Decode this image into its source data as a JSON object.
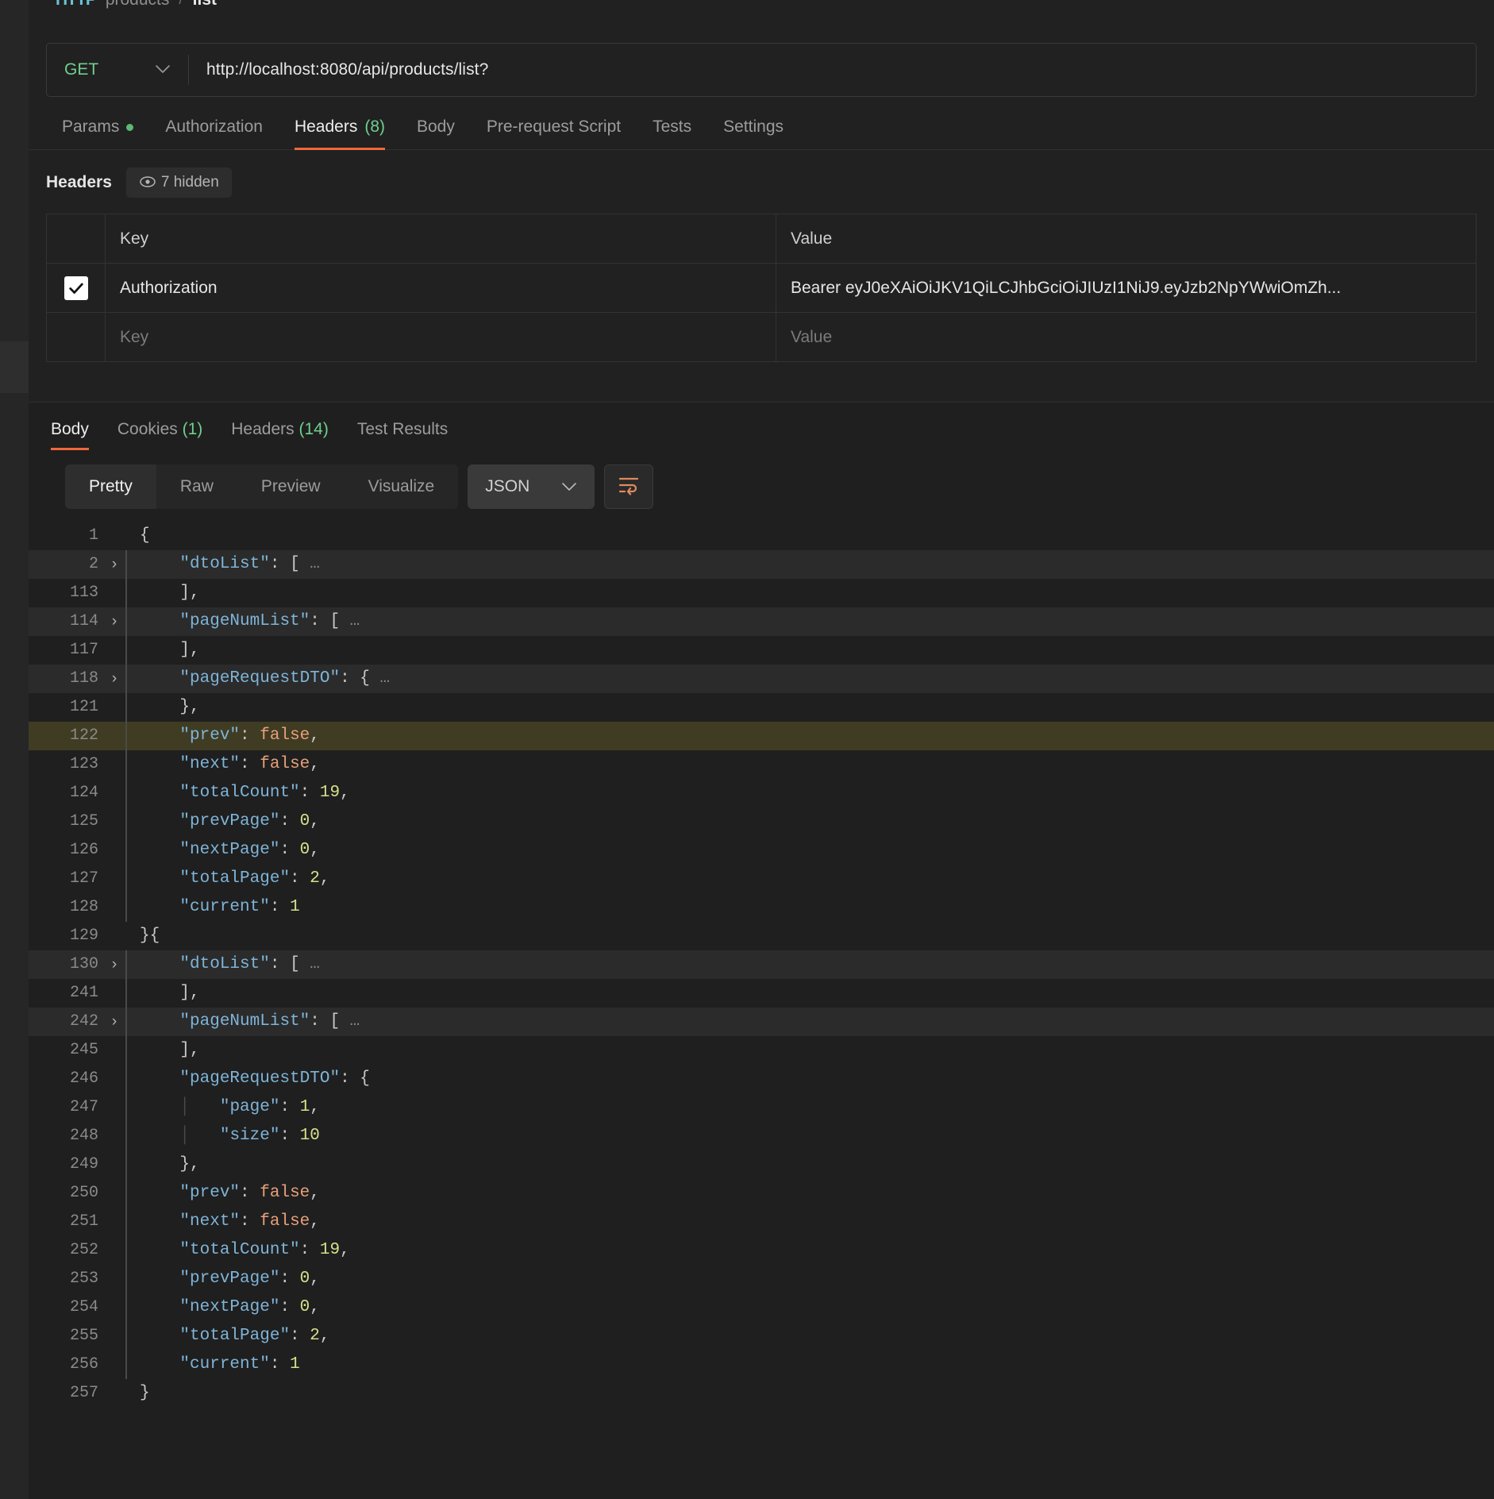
{
  "breadcrumb": {
    "icon": "http-icon",
    "segments": [
      "products"
    ],
    "separator": "/",
    "current": "list"
  },
  "request": {
    "method": "GET",
    "method_caret": "chevron-down-icon",
    "url": "http://localhost:8080/api/products/list?",
    "tabs": [
      {
        "label": "Params",
        "badge_dot": true,
        "active": false
      },
      {
        "label": "Authorization",
        "active": false
      },
      {
        "label": "Headers",
        "count": "(8)",
        "active": true
      },
      {
        "label": "Body",
        "active": false
      },
      {
        "label": "Pre-request Script",
        "active": false
      },
      {
        "label": "Tests",
        "active": false
      },
      {
        "label": "Settings",
        "active": false
      }
    ]
  },
  "headers_section": {
    "title": "Headers",
    "hidden_pill": "7 hidden",
    "columns": {
      "key": "Key",
      "value": "Value"
    },
    "rows": [
      {
        "checked": true,
        "key": "Authorization",
        "value": "Bearer eyJ0eXAiOiJKV1QiLCJhbGciOiJIUzI1NiJ9.eyJzb2NpYWwiOmZh..."
      }
    ],
    "placeholder_row": {
      "key": "Key",
      "value": "Value"
    }
  },
  "response": {
    "tabs": [
      {
        "label": "Body",
        "active": true
      },
      {
        "label": "Cookies",
        "count": "(1)",
        "active": false
      },
      {
        "label": "Headers",
        "count": "(14)",
        "active": false
      },
      {
        "label": "Test Results",
        "active": false
      }
    ],
    "format_buttons": [
      {
        "label": "Pretty",
        "active": true
      },
      {
        "label": "Raw",
        "active": false
      },
      {
        "label": "Preview",
        "active": false
      },
      {
        "label": "Visualize",
        "active": false
      }
    ],
    "language_select": {
      "value": "JSON",
      "caret": "chevron-down-icon"
    },
    "wrap_button": "word-wrap-icon"
  },
  "colors": {
    "accent": "#f0673a",
    "green": "#6fcf8e",
    "key": "#7fb4d8",
    "bool": "#e8a07a",
    "number": "#d7e08a",
    "highlight_row": "#3f3c23"
  },
  "code_lines": [
    {
      "n": "1",
      "arrow": false,
      "bar": false,
      "hl": "none",
      "tokens": [
        {
          "t": "brk",
          "v": "{"
        }
      ]
    },
    {
      "n": "2",
      "arrow": true,
      "bar": true,
      "hl": "grey",
      "tokens": [
        {
          "t": "sp",
          "v": "    "
        },
        {
          "t": "k",
          "v": "\"dtoList\""
        },
        {
          "t": "p",
          "v": ": "
        },
        {
          "t": "brk",
          "v": "["
        },
        {
          "t": "ell",
          "v": " …"
        }
      ]
    },
    {
      "n": "113",
      "arrow": false,
      "bar": true,
      "hl": "none",
      "tokens": [
        {
          "t": "sp",
          "v": "    "
        },
        {
          "t": "brk",
          "v": "],"
        }
      ]
    },
    {
      "n": "114",
      "arrow": true,
      "bar": true,
      "hl": "grey",
      "tokens": [
        {
          "t": "sp",
          "v": "    "
        },
        {
          "t": "k",
          "v": "\"pageNumList\""
        },
        {
          "t": "p",
          "v": ": "
        },
        {
          "t": "brk",
          "v": "["
        },
        {
          "t": "ell",
          "v": " …"
        }
      ]
    },
    {
      "n": "117",
      "arrow": false,
      "bar": true,
      "hl": "none",
      "tokens": [
        {
          "t": "sp",
          "v": "    "
        },
        {
          "t": "brk",
          "v": "],"
        }
      ]
    },
    {
      "n": "118",
      "arrow": true,
      "bar": true,
      "hl": "grey",
      "tokens": [
        {
          "t": "sp",
          "v": "    "
        },
        {
          "t": "k",
          "v": "\"pageRequestDTO\""
        },
        {
          "t": "p",
          "v": ": "
        },
        {
          "t": "brk",
          "v": "{"
        },
        {
          "t": "ell",
          "v": " …"
        }
      ]
    },
    {
      "n": "121",
      "arrow": false,
      "bar": true,
      "hl": "none",
      "tokens": [
        {
          "t": "sp",
          "v": "    "
        },
        {
          "t": "brk",
          "v": "},"
        }
      ]
    },
    {
      "n": "122",
      "arrow": false,
      "bar": true,
      "hl": "olive",
      "tokens": [
        {
          "t": "sp",
          "v": "    "
        },
        {
          "t": "k",
          "v": "\"prev\""
        },
        {
          "t": "p",
          "v": ": "
        },
        {
          "t": "bool",
          "v": "false"
        },
        {
          "t": "p",
          "v": ","
        }
      ]
    },
    {
      "n": "123",
      "arrow": false,
      "bar": true,
      "hl": "none",
      "tokens": [
        {
          "t": "sp",
          "v": "    "
        },
        {
          "t": "k",
          "v": "\"next\""
        },
        {
          "t": "p",
          "v": ": "
        },
        {
          "t": "bool",
          "v": "false"
        },
        {
          "t": "p",
          "v": ","
        }
      ]
    },
    {
      "n": "124",
      "arrow": false,
      "bar": true,
      "hl": "none",
      "tokens": [
        {
          "t": "sp",
          "v": "    "
        },
        {
          "t": "k",
          "v": "\"totalCount\""
        },
        {
          "t": "p",
          "v": ": "
        },
        {
          "t": "num",
          "v": "19"
        },
        {
          "t": "p",
          "v": ","
        }
      ]
    },
    {
      "n": "125",
      "arrow": false,
      "bar": true,
      "hl": "none",
      "tokens": [
        {
          "t": "sp",
          "v": "    "
        },
        {
          "t": "k",
          "v": "\"prevPage\""
        },
        {
          "t": "p",
          "v": ": "
        },
        {
          "t": "num",
          "v": "0"
        },
        {
          "t": "p",
          "v": ","
        }
      ]
    },
    {
      "n": "126",
      "arrow": false,
      "bar": true,
      "hl": "none",
      "tokens": [
        {
          "t": "sp",
          "v": "    "
        },
        {
          "t": "k",
          "v": "\"nextPage\""
        },
        {
          "t": "p",
          "v": ": "
        },
        {
          "t": "num",
          "v": "0"
        },
        {
          "t": "p",
          "v": ","
        }
      ]
    },
    {
      "n": "127",
      "arrow": false,
      "bar": true,
      "hl": "none",
      "tokens": [
        {
          "t": "sp",
          "v": "    "
        },
        {
          "t": "k",
          "v": "\"totalPage\""
        },
        {
          "t": "p",
          "v": ": "
        },
        {
          "t": "num",
          "v": "2"
        },
        {
          "t": "p",
          "v": ","
        }
      ]
    },
    {
      "n": "128",
      "arrow": false,
      "bar": true,
      "hl": "none",
      "tokens": [
        {
          "t": "sp",
          "v": "    "
        },
        {
          "t": "k",
          "v": "\"current\""
        },
        {
          "t": "p",
          "v": ": "
        },
        {
          "t": "num",
          "v": "1"
        }
      ]
    },
    {
      "n": "129",
      "arrow": false,
      "bar": false,
      "hl": "none",
      "tokens": [
        {
          "t": "brk",
          "v": "}{"
        }
      ]
    },
    {
      "n": "130",
      "arrow": true,
      "bar": true,
      "hl": "grey",
      "tokens": [
        {
          "t": "sp",
          "v": "    "
        },
        {
          "t": "k",
          "v": "\"dtoList\""
        },
        {
          "t": "p",
          "v": ": "
        },
        {
          "t": "brk",
          "v": "["
        },
        {
          "t": "ell",
          "v": " …"
        }
      ]
    },
    {
      "n": "241",
      "arrow": false,
      "bar": true,
      "hl": "none",
      "tokens": [
        {
          "t": "sp",
          "v": "    "
        },
        {
          "t": "brk",
          "v": "],"
        }
      ]
    },
    {
      "n": "242",
      "arrow": true,
      "bar": true,
      "hl": "grey",
      "tokens": [
        {
          "t": "sp",
          "v": "    "
        },
        {
          "t": "k",
          "v": "\"pageNumList\""
        },
        {
          "t": "p",
          "v": ": "
        },
        {
          "t": "brk",
          "v": "["
        },
        {
          "t": "ell",
          "v": " …"
        }
      ]
    },
    {
      "n": "245",
      "arrow": false,
      "bar": true,
      "hl": "none",
      "tokens": [
        {
          "t": "sp",
          "v": "    "
        },
        {
          "t": "brk",
          "v": "],"
        }
      ]
    },
    {
      "n": "246",
      "arrow": false,
      "bar": true,
      "hl": "none",
      "tokens": [
        {
          "t": "sp",
          "v": "    "
        },
        {
          "t": "k",
          "v": "\"pageRequestDTO\""
        },
        {
          "t": "p",
          "v": ": "
        },
        {
          "t": "brk",
          "v": "{"
        }
      ]
    },
    {
      "n": "247",
      "arrow": false,
      "bar": true,
      "hl": "none",
      "tokens": [
        {
          "t": "sp",
          "v": "    "
        },
        {
          "t": "innerbar",
          "v": "│"
        },
        {
          "t": "sp",
          "v": "   "
        },
        {
          "t": "k",
          "v": "\"page\""
        },
        {
          "t": "p",
          "v": ": "
        },
        {
          "t": "num",
          "v": "1"
        },
        {
          "t": "p",
          "v": ","
        }
      ]
    },
    {
      "n": "248",
      "arrow": false,
      "bar": true,
      "hl": "none",
      "tokens": [
        {
          "t": "sp",
          "v": "    "
        },
        {
          "t": "innerbar",
          "v": "│"
        },
        {
          "t": "sp",
          "v": "   "
        },
        {
          "t": "k",
          "v": "\"size\""
        },
        {
          "t": "p",
          "v": ": "
        },
        {
          "t": "num",
          "v": "10"
        }
      ]
    },
    {
      "n": "249",
      "arrow": false,
      "bar": true,
      "hl": "none",
      "tokens": [
        {
          "t": "sp",
          "v": "    "
        },
        {
          "t": "brk",
          "v": "},"
        }
      ]
    },
    {
      "n": "250",
      "arrow": false,
      "bar": true,
      "hl": "none",
      "tokens": [
        {
          "t": "sp",
          "v": "    "
        },
        {
          "t": "k",
          "v": "\"prev\""
        },
        {
          "t": "p",
          "v": ": "
        },
        {
          "t": "bool",
          "v": "false"
        },
        {
          "t": "p",
          "v": ","
        }
      ]
    },
    {
      "n": "251",
      "arrow": false,
      "bar": true,
      "hl": "none",
      "tokens": [
        {
          "t": "sp",
          "v": "    "
        },
        {
          "t": "k",
          "v": "\"next\""
        },
        {
          "t": "p",
          "v": ": "
        },
        {
          "t": "bool",
          "v": "false"
        },
        {
          "t": "p",
          "v": ","
        }
      ]
    },
    {
      "n": "252",
      "arrow": false,
      "bar": true,
      "hl": "none",
      "tokens": [
        {
          "t": "sp",
          "v": "    "
        },
        {
          "t": "k",
          "v": "\"totalCount\""
        },
        {
          "t": "p",
          "v": ": "
        },
        {
          "t": "num",
          "v": "19"
        },
        {
          "t": "p",
          "v": ","
        }
      ]
    },
    {
      "n": "253",
      "arrow": false,
      "bar": true,
      "hl": "none",
      "tokens": [
        {
          "t": "sp",
          "v": "    "
        },
        {
          "t": "k",
          "v": "\"prevPage\""
        },
        {
          "t": "p",
          "v": ": "
        },
        {
          "t": "num",
          "v": "0"
        },
        {
          "t": "p",
          "v": ","
        }
      ]
    },
    {
      "n": "254",
      "arrow": false,
      "bar": true,
      "hl": "none",
      "tokens": [
        {
          "t": "sp",
          "v": "    "
        },
        {
          "t": "k",
          "v": "\"nextPage\""
        },
        {
          "t": "p",
          "v": ": "
        },
        {
          "t": "num",
          "v": "0"
        },
        {
          "t": "p",
          "v": ","
        }
      ]
    },
    {
      "n": "255",
      "arrow": false,
      "bar": true,
      "hl": "none",
      "tokens": [
        {
          "t": "sp",
          "v": "    "
        },
        {
          "t": "k",
          "v": "\"totalPage\""
        },
        {
          "t": "p",
          "v": ": "
        },
        {
          "t": "num",
          "v": "2"
        },
        {
          "t": "p",
          "v": ","
        }
      ]
    },
    {
      "n": "256",
      "arrow": false,
      "bar": true,
      "hl": "none",
      "tokens": [
        {
          "t": "sp",
          "v": "    "
        },
        {
          "t": "k",
          "v": "\"current\""
        },
        {
          "t": "p",
          "v": ": "
        },
        {
          "t": "num",
          "v": "1"
        }
      ]
    },
    {
      "n": "257",
      "arrow": false,
      "bar": false,
      "hl": "none",
      "tokens": [
        {
          "t": "brk",
          "v": "}"
        }
      ]
    }
  ]
}
